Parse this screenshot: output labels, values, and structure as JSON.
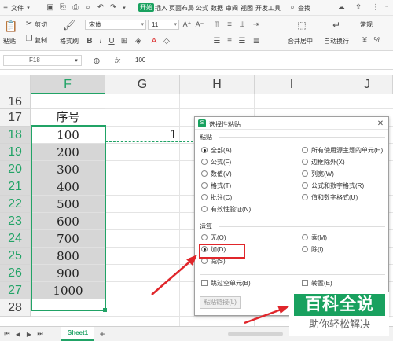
{
  "menu": {
    "file": "文件",
    "tabs": [
      "开始",
      "插入",
      "页面布局",
      "公式",
      "数据",
      "审阅",
      "视图",
      "开发工具"
    ],
    "search": "查找"
  },
  "ribbon": {
    "paste": "粘贴",
    "cut": "剪切",
    "copy": "复制",
    "format_painter": "格式刷",
    "font_name": "宋体",
    "font_size": "11",
    "merge_center": "合并居中",
    "wrap_text": "自动换行",
    "number_format": "常规"
  },
  "formula_bar": {
    "name_box": "F18",
    "fx": "fx",
    "value": "100"
  },
  "columns": [
    "F",
    "G",
    "H",
    "I",
    "J"
  ],
  "rows": [
    {
      "num": "16",
      "f": ""
    },
    {
      "num": "17",
      "f": "序号"
    },
    {
      "num": "18",
      "f": "100"
    },
    {
      "num": "19",
      "f": "200"
    },
    {
      "num": "20",
      "f": "300"
    },
    {
      "num": "21",
      "f": "400"
    },
    {
      "num": "22",
      "f": "500"
    },
    {
      "num": "23",
      "f": "600"
    },
    {
      "num": "24",
      "f": "700"
    },
    {
      "num": "25",
      "f": "800"
    },
    {
      "num": "26",
      "f": "900"
    },
    {
      "num": "27",
      "f": "1000"
    },
    {
      "num": "28",
      "f": ""
    }
  ],
  "g18_value": "1",
  "dialog": {
    "title": "选择性粘贴",
    "paste_group": "粘贴",
    "paste_left": [
      "全部(A)",
      "公式(F)",
      "数值(V)",
      "格式(T)",
      "批注(C)",
      "有效性验证(N)"
    ],
    "paste_right": [
      "所有使用源主题的单元(H)",
      "边框除外(X)",
      "列宽(W)",
      "公式和数字格式(R)",
      "值和数字格式(U)"
    ],
    "operation_group": "运算",
    "op_left": [
      "无(O)",
      "加(D)",
      "减(S)"
    ],
    "op_right": [
      "乘(M)",
      "除(I)"
    ],
    "skip_blanks": "跳过空单元(B)",
    "transpose": "转置(E)",
    "paste_link": "粘贴链接(L)"
  },
  "sheet_tab": "Sheet1",
  "watermark": {
    "line1": "百科全说",
    "line2": "助你轻松解决"
  },
  "colors": {
    "accent": "#19a15f",
    "selection_border": "#21a366",
    "highlight_red": "#e0262b"
  }
}
